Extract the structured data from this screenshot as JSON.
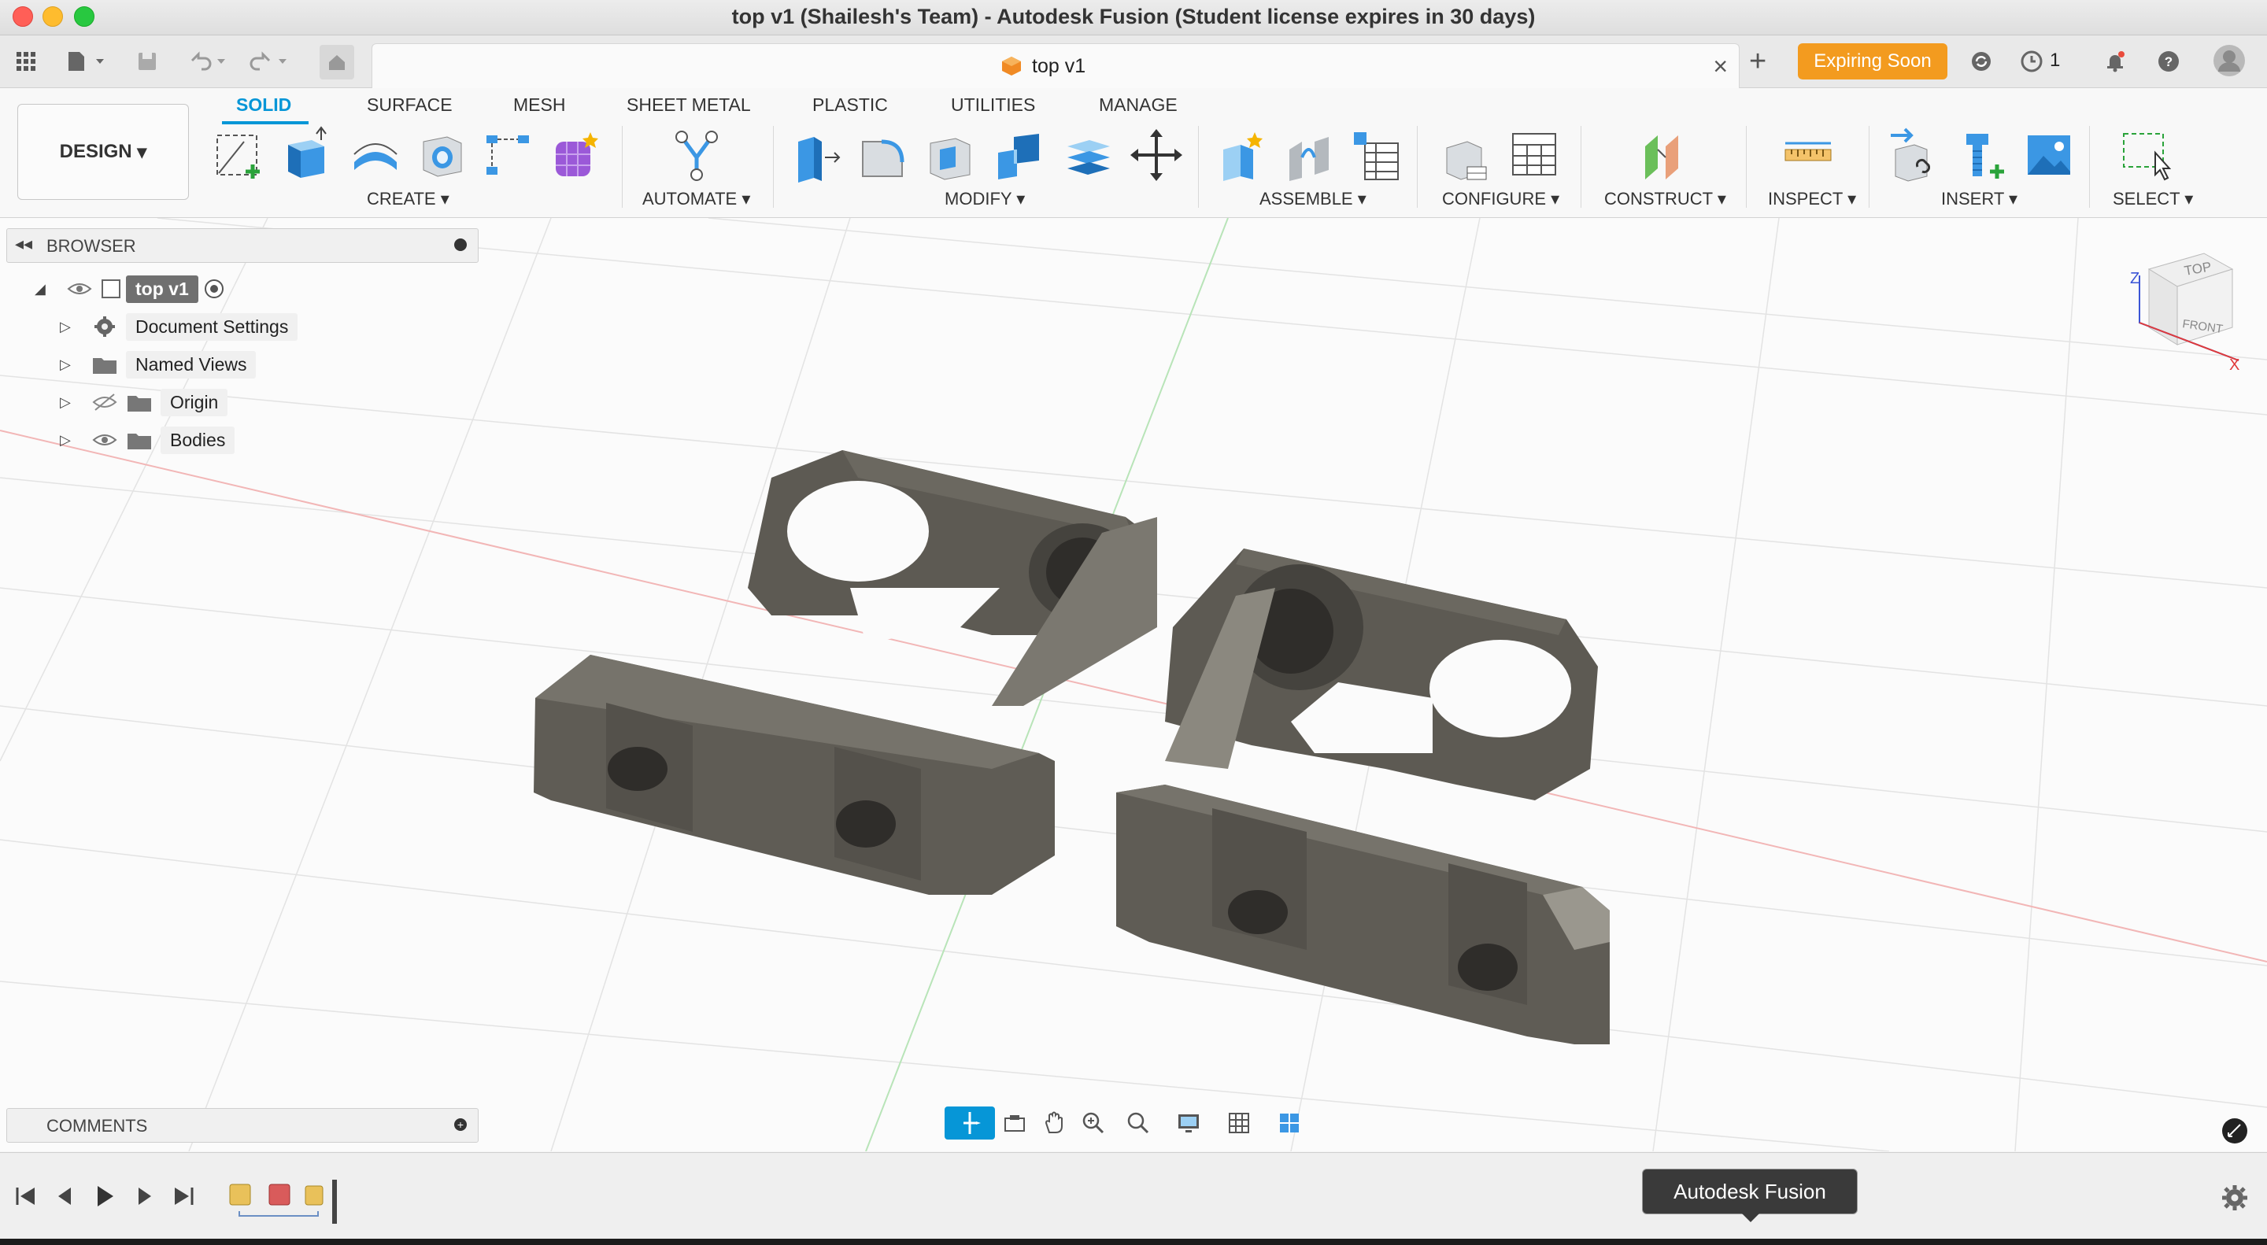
{
  "window": {
    "title": "top v1 (Shailesh's Team) - Autodesk Fusion (Student license expires in 30 days)"
  },
  "tabbar": {
    "doc_tab_label": "top v1",
    "expiring_label": "Expiring Soon",
    "job_count": "1"
  },
  "toolbar": {
    "workspace_label": "DESIGN",
    "tabs": [
      {
        "label": "SOLID",
        "active": true
      },
      {
        "label": "SURFACE"
      },
      {
        "label": "MESH"
      },
      {
        "label": "SHEET METAL"
      },
      {
        "label": "PLASTIC"
      },
      {
        "label": "UTILITIES"
      },
      {
        "label": "MANAGE"
      }
    ],
    "groups": [
      {
        "label": "CREATE"
      },
      {
        "label": "AUTOMATE"
      },
      {
        "label": "MODIFY"
      },
      {
        "label": "ASSEMBLE"
      },
      {
        "label": "CONFIGURE"
      },
      {
        "label": "CONSTRUCT"
      },
      {
        "label": "INSPECT"
      },
      {
        "label": "INSERT"
      },
      {
        "label": "SELECT"
      }
    ]
  },
  "browser": {
    "title": "BROWSER",
    "root": "top v1",
    "items": [
      {
        "label": "Document Settings",
        "icon": "gear-icon"
      },
      {
        "label": "Named Views",
        "icon": "folder-icon"
      },
      {
        "label": "Origin",
        "icon": "folder-icon",
        "visible": false
      },
      {
        "label": "Bodies",
        "icon": "folder-icon",
        "visible": true
      }
    ]
  },
  "viewcube": {
    "top": "TOP",
    "front": "FRONT",
    "z_axis": "Z",
    "x_axis": "X"
  },
  "comments": {
    "title": "COMMENTS"
  },
  "timeline": {
    "tooltip": "Autodesk Fusion"
  },
  "colors": {
    "accent": "#0696d7",
    "expiring": "#f39b1f",
    "body": "#5a5750"
  }
}
